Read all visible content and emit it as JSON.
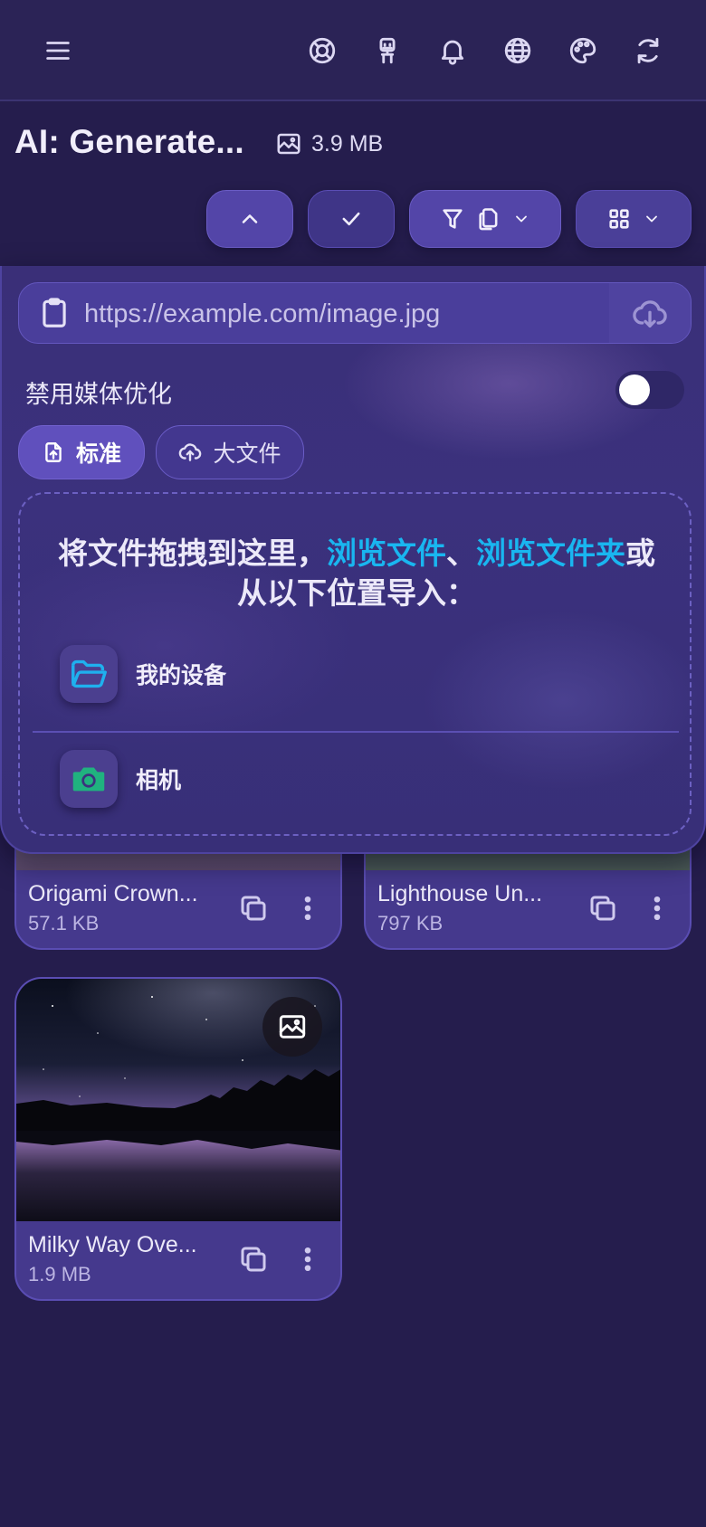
{
  "header": {
    "title": "AI: Generate...",
    "file_size": "3.9 MB"
  },
  "upload": {
    "url_placeholder": "https://example.com/image.jpg",
    "optimize_label": "禁用媒体优化",
    "optimize_enabled": false,
    "modes": [
      {
        "label": "标准",
        "active": true
      },
      {
        "label": "大文件",
        "active": false
      }
    ],
    "drop_text_prefix": "将文件拖拽到这里，",
    "browse_files": "浏览文件",
    "separator": "、",
    "browse_folder": "浏览文件夹",
    "drop_text_suffix": "或",
    "drop_text_line2": "从以下位置导入：",
    "sources": [
      {
        "label": "我的设备",
        "icon": "folder-icon"
      },
      {
        "label": "相机",
        "icon": "camera-icon"
      }
    ]
  },
  "gallery": {
    "items": [
      {
        "name": "Origami Crown...",
        "size": "57.1 KB"
      },
      {
        "name": "Lighthouse Un...",
        "size": "797 KB"
      },
      {
        "name": "Milky Way Ove...",
        "size": "1.9 MB"
      }
    ]
  },
  "colors": {
    "background": "#251d4d",
    "accent": "#5345a8",
    "link": "#19b6f0",
    "camera": "#20b27f"
  }
}
